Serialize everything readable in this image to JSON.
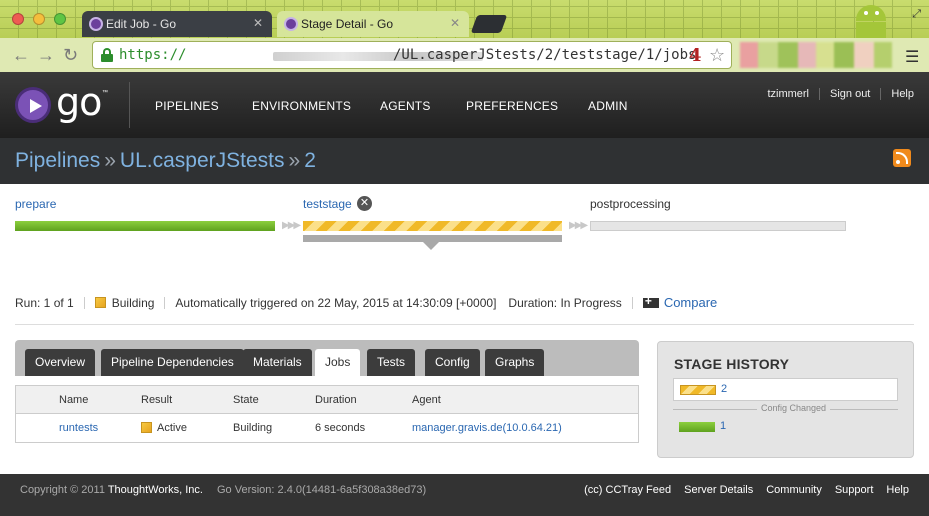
{
  "browser": {
    "tabs": [
      {
        "label": "Edit Job - Go",
        "active": false
      },
      {
        "label": "Stage Detail - Go",
        "active": true
      }
    ],
    "url": {
      "scheme": "https://",
      "path": "/UL.casperJStests/2/teststage/1/jobs",
      "extension_badge": "4"
    },
    "icons": [
      "back-icon",
      "forward-icon",
      "reload-icon",
      "lock-icon",
      "star-icon",
      "menu-icon"
    ]
  },
  "header": {
    "logo_text": "go",
    "logo_tm": "™",
    "nav": [
      "PIPELINES",
      "ENVIRONMENTS",
      "AGENTS",
      "PREFERENCES",
      "ADMIN"
    ],
    "user": {
      "name": "tzimmerl",
      "signout": "Sign out",
      "help": "Help"
    }
  },
  "breadcrumb": {
    "pipelines": "Pipelines",
    "sep": "»",
    "pipeline": "UL.casperJStests",
    "counter": "2"
  },
  "stages": [
    {
      "name": "prepare",
      "status": "passed"
    },
    {
      "name": "teststage",
      "status": "building"
    },
    {
      "name": "postprocessing",
      "status": "not-run"
    }
  ],
  "run_info": {
    "run": "Run: 1 of 1",
    "status": "Building",
    "trigger": "Automatically triggered on 22 May, 2015 at 14:30:09 [+0000]",
    "duration": "Duration: In Progress",
    "compare": "Compare"
  },
  "tabs": [
    {
      "label": "Overview",
      "active": false
    },
    {
      "label": "Pipeline Dependencies",
      "active": false
    },
    {
      "label": "Materials",
      "active": false
    },
    {
      "label": "Jobs",
      "active": true
    },
    {
      "label": "Tests",
      "active": false
    },
    {
      "label": "Config",
      "active": false
    },
    {
      "label": "Graphs",
      "active": false
    }
  ],
  "jobs_table": {
    "headers": [
      "Name",
      "Result",
      "State",
      "Duration",
      "Agent"
    ],
    "rows": [
      {
        "name": "runtests",
        "result": "Active",
        "state": "Building",
        "duration": "6 seconds",
        "agent": "manager.gravis.de(10.0.64.21)"
      }
    ]
  },
  "stage_history": {
    "title": "STAGE HISTORY",
    "entries": [
      {
        "counter": "2",
        "status": "building"
      },
      {
        "counter": "1",
        "status": "passed"
      }
    ],
    "config_changed": "Config Changed"
  },
  "footer": {
    "copyright": "Copyright © 2011",
    "company": "ThoughtWorks, Inc.",
    "version": "Go Version: 2.4.0(14481-6a5f308a38ed73)",
    "links": [
      "(cc) CCTray Feed",
      "Server Details",
      "Community",
      "Support",
      "Help"
    ]
  },
  "colors": {
    "link": "#2a67b1",
    "passed": "#6bb22a",
    "building": "#f0b928",
    "header_bg": "#2b2b2b"
  }
}
